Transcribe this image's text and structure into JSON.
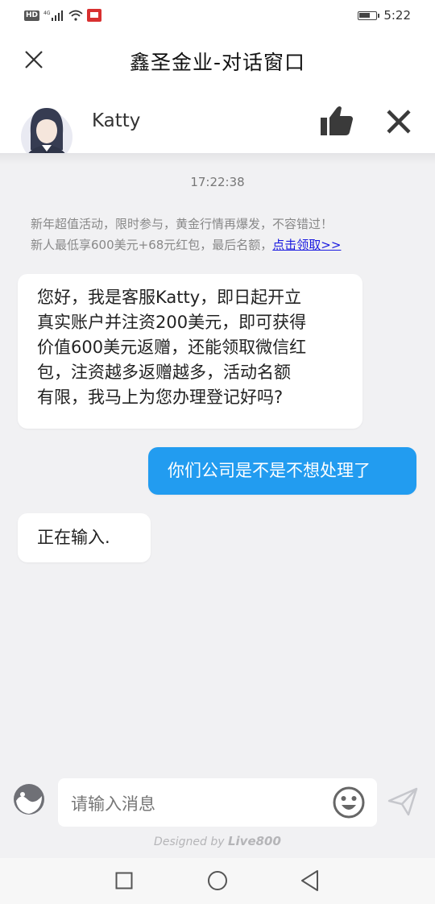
{
  "status_bar": {
    "network_label": "HD",
    "signal_label": "4G",
    "time": "5:22",
    "battery_level": 0.7
  },
  "header": {
    "title": "鑫圣金业-对话窗口",
    "close_icon": "close-x-icon"
  },
  "agent": {
    "name": "Katty",
    "avatar_icon": "agent-avatar-icon",
    "like_icon": "thumbs-up-icon",
    "end_icon": "close-icon"
  },
  "chat": {
    "timestamp": "17:22:38",
    "notice_line1": "新年超值活动，限时参与，黄金行情再爆发，不容错过！",
    "notice_line2": "新人最低享600美元+68元红包，最后名额，",
    "notice_link": "点击领取>>",
    "messages": [
      {
        "sender": "agent",
        "lines": [
          "您好，我是客服Katty，即日起开立",
          "真实账户并注资200美元，即可获得",
          "价值600美元返赠，还能领取微信红",
          "包，注资越多返赠越多，活动名额",
          "有限，我马上为您办理登记好吗?"
        ]
      },
      {
        "sender": "user",
        "text": "你们公司是不是不想处理了"
      },
      {
        "sender": "agent",
        "text": "正在输入."
      }
    ]
  },
  "input": {
    "placeholder": "请输入消息",
    "theme_icon": "theme-toggle-icon",
    "emoji_icon": "emoji-smile-icon",
    "send_icon": "send-paper-plane-icon"
  },
  "footer": {
    "prefix": "Designed by",
    "brand": "Live800"
  },
  "colors": {
    "accent": "#229cf0",
    "background": "#f1f1f3",
    "link": "#1a1ae0"
  }
}
